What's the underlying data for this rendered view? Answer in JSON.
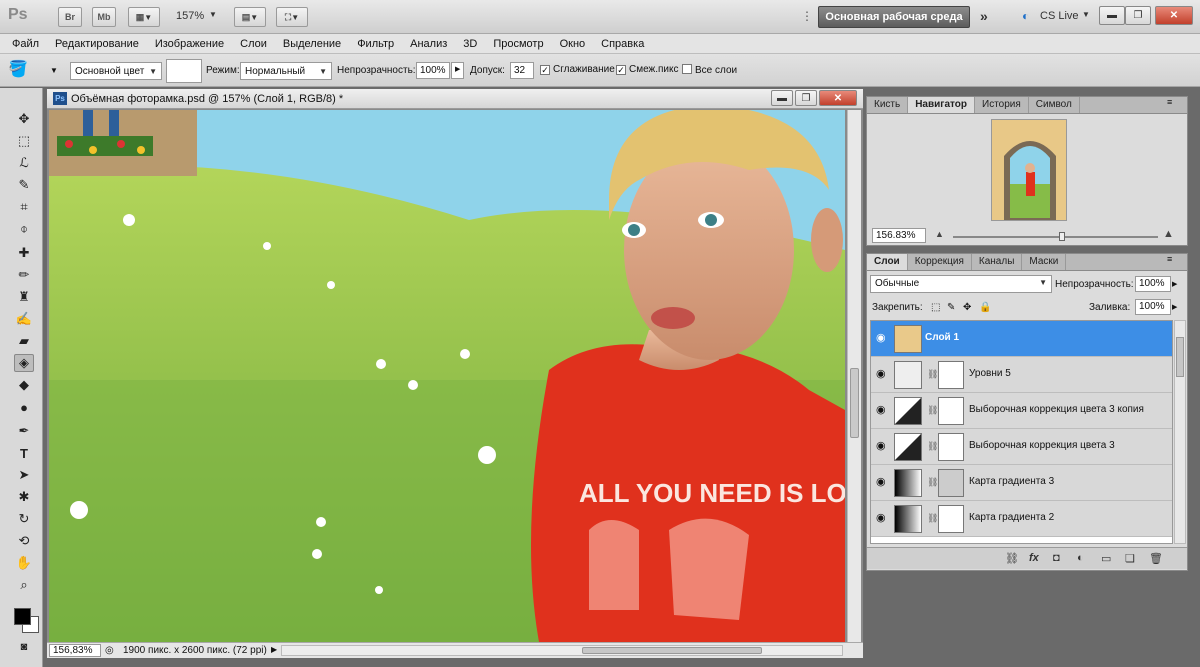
{
  "app": {
    "logo": "Ps",
    "bridge_label": "Br",
    "minibridge_label": "Mb",
    "zoom": "157%",
    "workspace": "Основная рабочая среда",
    "cs_live": "CS Live"
  },
  "menu": [
    "Файл",
    "Редактирование",
    "Изображение",
    "Слои",
    "Выделение",
    "Фильтр",
    "Анализ",
    "3D",
    "Просмотр",
    "Окно",
    "Справка"
  ],
  "options": {
    "fill_source": "Основной цвет",
    "mode_label": "Режим:",
    "mode_value": "Нормальный",
    "opacity_label": "Непрозрачность:",
    "opacity_value": "100%",
    "tolerance_label": "Допуск:",
    "tolerance_value": "32",
    "antialias": "Сглаживание",
    "contiguous": "Смеж.пикс",
    "all_layers": "Все слои"
  },
  "document": {
    "title": "Объёмная фоторамка.psd @ 157% (Слой 1, RGB/8) *",
    "zoom": "156,83%",
    "info": "1900 пикс. x 2600 пикс. (72 ppi)",
    "shirt_text": "ALL YOU NEED IS LOVE"
  },
  "navigator": {
    "tabs": [
      "Кисть",
      "Навигатор",
      "История",
      "Символ"
    ],
    "active_tab": "Навигатор",
    "zoom": "156.83%"
  },
  "layers_panel": {
    "tabs": [
      "Слои",
      "Коррекция",
      "Каналы",
      "Маски"
    ],
    "active_tab": "Слои",
    "blend_mode": "Обычные",
    "opacity_label": "Непрозрачность:",
    "opacity_value": "100%",
    "lock_label": "Закрепить:",
    "fill_label": "Заливка:",
    "fill_value": "100%",
    "layers": [
      {
        "name": "Слой 1",
        "selected": true
      },
      {
        "name": "Уровни 5",
        "selected": false
      },
      {
        "name": "Выборочная коррекция цвета 3 копия",
        "selected": false
      },
      {
        "name": "Выборочная коррекция цвета 3",
        "selected": false
      },
      {
        "name": "Карта градиента 3",
        "selected": false
      },
      {
        "name": "Карта градиента 2",
        "selected": false
      }
    ]
  },
  "colors": {
    "selection": "#3d8ee6",
    "shirt": "#e0311d",
    "grass": "#9cc94a",
    "sky": "#8fd3ea"
  }
}
